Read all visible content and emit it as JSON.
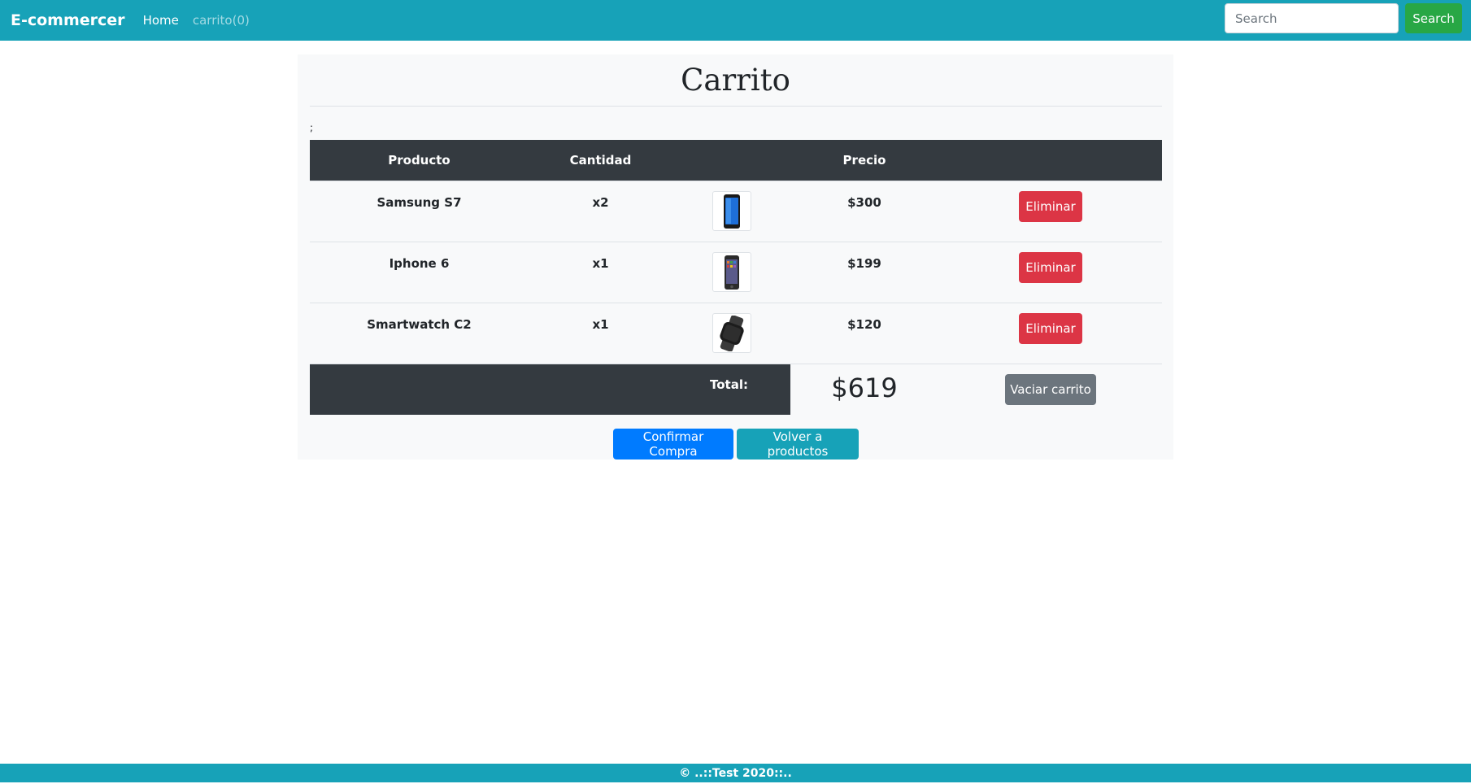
{
  "navbar": {
    "brand": "E-commercer",
    "home_label": "Home",
    "cart_label": "carrito(0)",
    "search_placeholder": "Search",
    "search_button_label": "Search"
  },
  "main": {
    "title": "Carrito",
    "stray_text": ";",
    "table": {
      "headers": [
        "Producto",
        "Cantidad",
        "",
        "Precio",
        ""
      ],
      "rows": [
        {
          "product": "Samsung S7",
          "quantity": "x2",
          "image_icon": "smartphone-icon",
          "price": "$300",
          "action_label": "Eliminar"
        },
        {
          "product": "Iphone 6",
          "quantity": "x1",
          "image_icon": "iphone-icon",
          "price": "$199",
          "action_label": "Eliminar"
        },
        {
          "product": "Smartwatch C2",
          "quantity": "x1",
          "image_icon": "smartwatch-icon",
          "price": "$120",
          "action_label": "Eliminar"
        }
      ],
      "total_label": "Total:",
      "total_value": "$619",
      "empty_cart_label": "Vaciar carrito"
    },
    "confirm_label": "Confirmar Compra",
    "back_label": "Volver a productos"
  },
  "footer": {
    "text": "© ..::Test 2020::.."
  },
  "colors": {
    "navbar": "#17a2b8",
    "table_header": "#343a40",
    "danger": "#dc3545",
    "secondary": "#6c757d",
    "primary": "#007bff",
    "info": "#17a2b8",
    "success": "#28a745"
  }
}
